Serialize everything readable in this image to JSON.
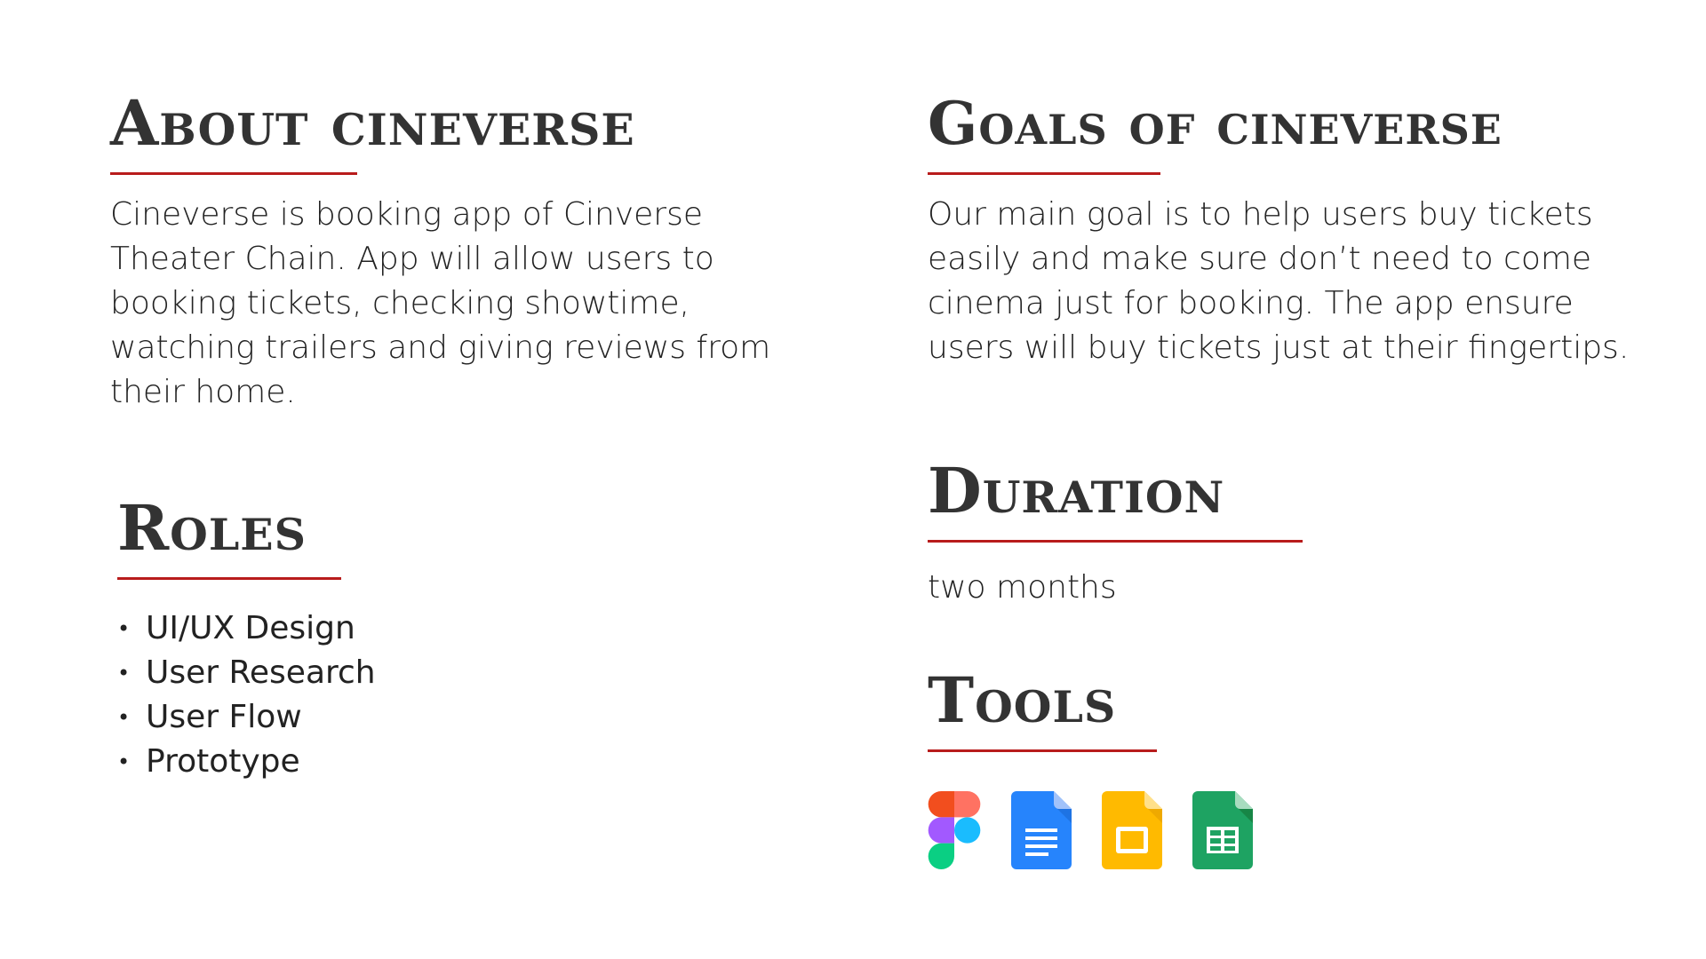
{
  "about": {
    "heading": "About cineverse",
    "text": "Cineverse is booking app of Cinverse Theater Chain. App will allow users to booking tickets, checking showtime, watching trailers and giving reviews from their home."
  },
  "roles": {
    "heading": "Roles",
    "items": [
      "UI/UX Design",
      "User Research",
      "User Flow",
      "Prototype"
    ]
  },
  "goals": {
    "heading": "Goals of cineverse",
    "text": "Our main goal is to help users buy tickets easily and make sure don’t need to come cinema just for booking. The app ensure users will buy tickets just at their fingertips."
  },
  "duration": {
    "heading": "Duration",
    "value": "two months"
  },
  "tools": {
    "heading": "Tools",
    "icons": [
      "figma-icon",
      "google-docs-icon",
      "google-slides-icon",
      "google-sheets-icon"
    ]
  },
  "colors": {
    "accent": "#b81c1c",
    "text": "#333333"
  }
}
